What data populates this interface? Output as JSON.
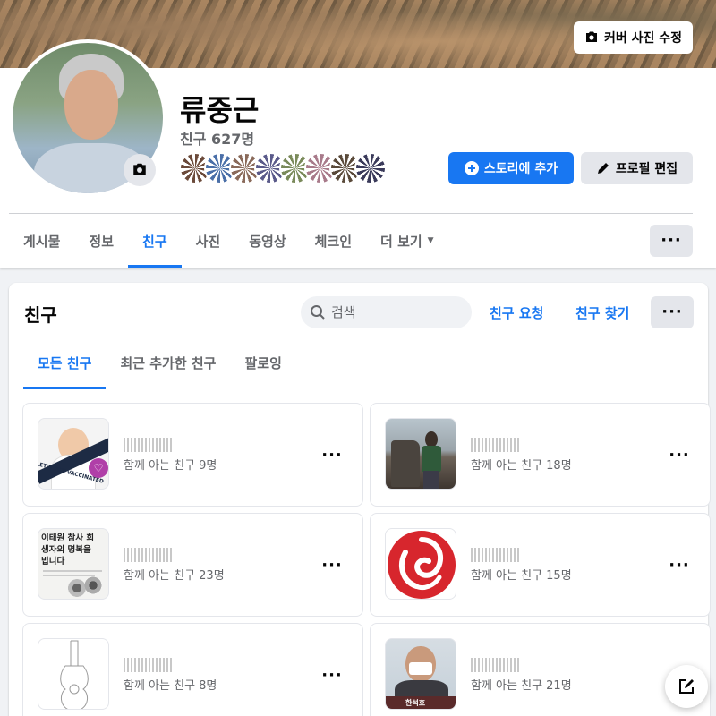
{
  "profile": {
    "name": "류중근",
    "friend_count": "친구 627명",
    "cover_button": "커버 사진 수정",
    "add_story_button": "스토리에 추가",
    "edit_profile_button": "프로필 편집"
  },
  "tabs": [
    {
      "label": "게시물"
    },
    {
      "label": "정보"
    },
    {
      "label": "친구"
    },
    {
      "label": "사진"
    },
    {
      "label": "동영상"
    },
    {
      "label": "체크인"
    },
    {
      "label": "더 보기"
    }
  ],
  "friends": {
    "title": "친구",
    "search_placeholder": "검색",
    "friend_requests": "친구 요청",
    "find_friends": "친구 찾기",
    "subtabs": [
      {
        "label": "모든 친구"
      },
      {
        "label": "최근 추가한 친구"
      },
      {
        "label": "팔로잉"
      }
    ],
    "items": [
      {
        "mutual": "함께 아는 친구 9명"
      },
      {
        "mutual": "함께 아는 친구 18명"
      },
      {
        "mutual": "함께 아는 친구 23명"
      },
      {
        "mutual": "함께 아는 친구 15명"
      },
      {
        "mutual": "함께 아는 친구 8명"
      },
      {
        "mutual": "함께 아는 친구 21명"
      }
    ],
    "thumb_texts": {
      "vaccine": "LET'S GET VACCINATED",
      "memorial_title": "이태원 참사 희생자의 명복을 빕니다",
      "person_label": "한석호"
    }
  },
  "colors": {
    "accent": "#1877f2",
    "secondary_bg": "#e4e6eb",
    "page_bg": "#f0f2f5",
    "muted_text": "#65676b"
  }
}
